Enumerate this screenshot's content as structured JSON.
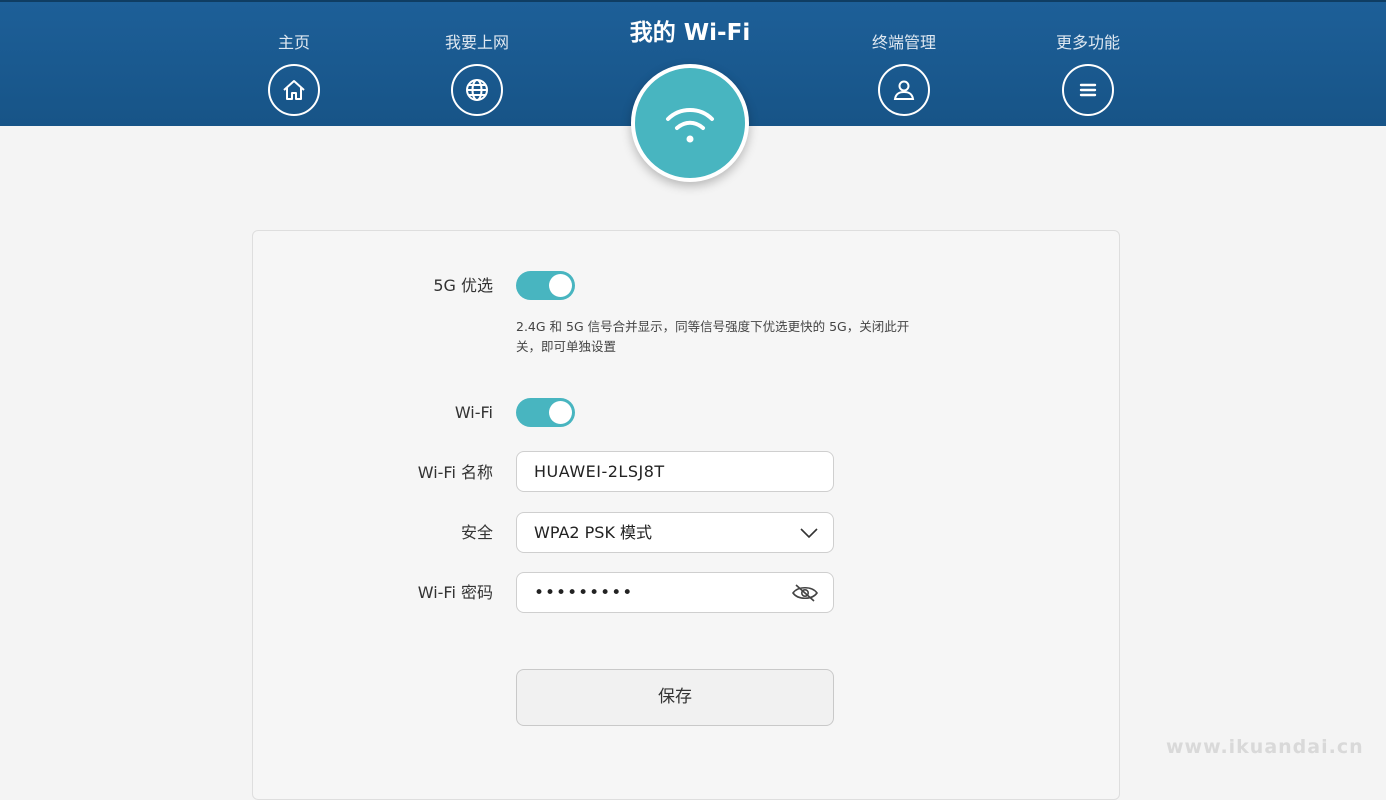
{
  "header": {
    "title": "我的 Wi-Fi",
    "nav": [
      {
        "label": "主页",
        "icon": "home-icon"
      },
      {
        "label": "我要上网",
        "icon": "globe-icon"
      },
      {
        "label": "终端管理",
        "icon": "user-icon"
      },
      {
        "label": "更多功能",
        "icon": "menu-icon"
      }
    ],
    "active_icon": "wifi-icon"
  },
  "form": {
    "band_steering": {
      "label": "5G 优选",
      "enabled": true,
      "hint_line1": "2.4G 和 5G 信号合并显示，同等信号强度下优选更快的 5G，关闭此开",
      "hint_line2": "关，即可单独设置"
    },
    "wifi": {
      "label": "Wi-Fi",
      "enabled": true
    },
    "ssid": {
      "label": "Wi-Fi 名称",
      "value": "HUAWEI-2LSJ8T"
    },
    "security": {
      "label": "安全",
      "value": "WPA2 PSK 模式"
    },
    "password": {
      "label": "Wi-Fi 密码",
      "value": "•••••••••"
    },
    "save_label": "保存"
  },
  "watermark": "www.ikuandai.cn",
  "colors": {
    "header": "#1d5f98",
    "accent": "#48b5c0"
  }
}
